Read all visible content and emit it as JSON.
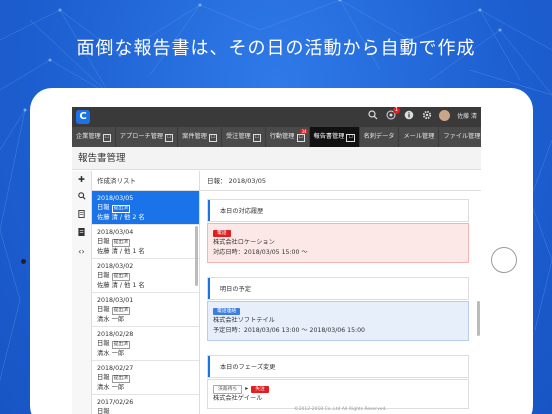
{
  "headline": "面倒な報告書は、その日の活動から自動で作成",
  "app": {
    "logo": "C",
    "user_name": "佐藤 清",
    "notification_count": "1"
  },
  "nav": {
    "items": [
      {
        "label": "企業管理",
        "tag": "☐"
      },
      {
        "label": "アプローチ管理",
        "tag": "☐"
      },
      {
        "label": "案件管理",
        "tag": "☐"
      },
      {
        "label": "受注管理",
        "tag": "☐"
      },
      {
        "label": "行動管理",
        "tag": "☐",
        "badge": "34"
      },
      {
        "label": "報告書管理",
        "tag": "☐"
      },
      {
        "label": "名刺データ",
        "tag": ""
      },
      {
        "label": "メール管理",
        "tag": ""
      },
      {
        "label": "ファイル管理",
        "tag": ""
      }
    ],
    "active_index": 5
  },
  "page_title": "報告書管理",
  "list": {
    "header": "作成済リスト",
    "items": [
      {
        "date": "2018/03/05",
        "type": "日報",
        "status": "提出済",
        "author": "佐藤 清 / 他 2 名"
      },
      {
        "date": "2018/03/04",
        "type": "日報",
        "status": "提出済",
        "author": "佐藤 清 / 他 1 名"
      },
      {
        "date": "2018/03/02",
        "type": "日報",
        "status": "提出済",
        "author": "佐藤 清 / 他 1 名"
      },
      {
        "date": "2018/03/01",
        "type": "日報",
        "status": "提出済",
        "author": "清水 一郎"
      },
      {
        "date": "2018/02/28",
        "type": "日報",
        "status": "提出済",
        "author": "清水 一郎"
      },
      {
        "date": "2018/02/27",
        "type": "日報",
        "status": "提出済",
        "author": "清水 一郎"
      },
      {
        "date": "2017/02/26",
        "type": "日報",
        "status": "",
        "author": ""
      }
    ]
  },
  "detail": {
    "header": "日報： 2018/03/05",
    "section1": {
      "title": "本日の対応履歴",
      "tag": "電話",
      "company": "株式会社ロケーション",
      "datetime": "対応日時：2018/03/05 15:00 ～"
    },
    "section2": {
      "title": "明日の予定",
      "tag": "電話連絡",
      "company": "株式会社ソフトテイル",
      "datetime": "予定日時：2018/03/06 13:00 ～ 2018/03/06 15:00"
    },
    "section3": {
      "title": "本日のフェーズ変更",
      "from": "決裁待ち",
      "to": "失注",
      "company": "株式会社ゲイール"
    }
  },
  "copyright": "©2012-2018 Co.,Ltd All Rights Reserved.",
  "colors": {
    "accent": "#1a73e8",
    "background": "#1f67d8",
    "danger": "#e02020"
  }
}
